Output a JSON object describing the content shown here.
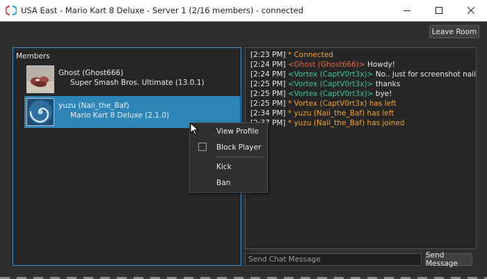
{
  "window": {
    "title": "USA East - Mario Kart 8 Deluxe - Server 1 (2/16 members) - connected",
    "app_icon": "yuzu-icon",
    "controls": [
      "minimize-icon",
      "maximize-icon",
      "close-icon"
    ]
  },
  "toolbar": {
    "leave_label": "Leave Room"
  },
  "members": {
    "header": "Members",
    "items": [
      {
        "name": "Ghost (Ghost666)",
        "game": "Super Smash Bros. Ultimate (13.0.1)",
        "selected": false
      },
      {
        "name": "yuzu (Naii_the_Baf)",
        "game": "Mario Kart 8 Deluxe (2.1.0)",
        "selected": true
      }
    ]
  },
  "chat": {
    "lines": [
      {
        "time": "[2:23 PM]",
        "system": "* Connected"
      },
      {
        "time": "[2:24 PM]",
        "nick": "<Ghost (Ghost666)>",
        "nick_color": "#e06c4a",
        "text": "Howdy!"
      },
      {
        "time": "[2:24 PM]",
        "nick": "<Vortex (CaptV0rt3x)>",
        "nick_color": "#3cc4a0",
        "text": "No.. just for screenshot naii"
      },
      {
        "time": "[2:25 PM]",
        "nick": "<Vortex (CaptV0rt3x)>",
        "nick_color": "#3cc4a0",
        "text": "thanks"
      },
      {
        "time": "[2:25 PM]",
        "nick": "<Vortex (CaptV0rt3x)>",
        "nick_color": "#3cc4a0",
        "text": "bye!"
      },
      {
        "time": "[2:25 PM]",
        "system": "* Vortex (CaptV0rt3x) has left"
      },
      {
        "time": "[2:34 PM]",
        "system": "* yuzu (Naii_the_Baf) has left"
      },
      {
        "time": "[2:37 PM]",
        "system": "* yuzu (Naii_the_Baf) has joined"
      }
    ],
    "input_placeholder": "Send Chat Message",
    "send_label": "Send Message"
  },
  "context_menu": {
    "view_profile": "View Profile",
    "block_player": "Block Player",
    "block_checked": false,
    "kick": "Kick",
    "ban": "Ban"
  },
  "colors": {
    "accent": "#3d8ec9",
    "selection": "#2e86b8",
    "system_message": "#f0a030"
  }
}
